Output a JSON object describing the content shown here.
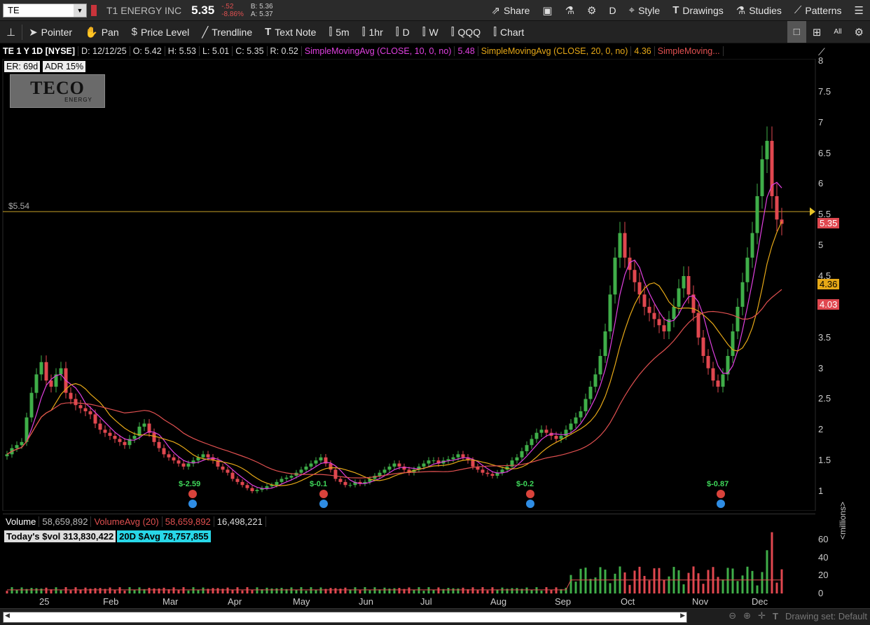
{
  "topbar": {
    "symbol": "TE",
    "company": "T1 ENERGY INC",
    "last": "5.35",
    "change": "-.52",
    "change_pct": "-8.86%",
    "bid": "B: 5.36",
    "ask": "A: 5.37",
    "share": "Share",
    "period": "D",
    "style": "Style",
    "drawings": "Drawings",
    "studies": "Studies",
    "patterns": "Patterns"
  },
  "toolbar": {
    "pointer": "Pointer",
    "pan": "Pan",
    "price_level": "Price Level",
    "trendline": "Trendline",
    "text_note": "Text Note",
    "t5m": "5m",
    "t1hr": "1hr",
    "tD": "D",
    "tW": "W",
    "qqq": "QQQ",
    "chart": "Chart",
    "all": "All"
  },
  "header": {
    "title": "TE 1 Y 1D [NYSE]",
    "date": "D: 12/12/25",
    "open": "O: 5.42",
    "high": "H: 5.53",
    "low": "L: 5.01",
    "close": "C: 5.35",
    "range": "R: 0.52",
    "sma10": "SimpleMovingAvg (CLOSE, 10, 0, no)",
    "sma10_val": "5.48",
    "sma20": "SimpleMovingAvg (CLOSE, 20, 0, no)",
    "sma20_val": "4.36",
    "sma_more": "SimpleMoving..."
  },
  "badges": {
    "er": "ER: 69d",
    "adr": "ADR 15%",
    "logo_word": "TECO",
    "logo_sub": "ENERGY"
  },
  "price_line": {
    "label": "$5.54",
    "value": 5.54
  },
  "price_axis": {
    "ticks": [
      "8",
      "7.5",
      "7",
      "6.5",
      "6",
      "5.5",
      "5",
      "4.5",
      "4",
      "3.5",
      "3",
      "2.5",
      "2",
      "1.5",
      "1"
    ],
    "tag_last": "5.35",
    "tag_sma20": "4.36",
    "tag_sma50": "4.03"
  },
  "earnings": [
    "$-2.59",
    "$-0.1",
    "$-0.2",
    "$-0.87"
  ],
  "volume": {
    "label": "Volume",
    "value": "58,659,892",
    "avg_label": "VolumeAvg (20)",
    "avg_value": "58,659,892",
    "avg2": "16,498,221",
    "today": "Today's $vol 313,830,422",
    "avg20": "20D $Avg 78,757,855",
    "ticks": [
      "60",
      "40",
      "20",
      "0"
    ],
    "unit": "<millions>"
  },
  "x_axis": [
    "25",
    "Feb",
    "Mar",
    "Apr",
    "May",
    "Jun",
    "Jul",
    "Aug",
    "Sep",
    "Oct",
    "Nov",
    "Dec"
  ],
  "bottom": {
    "drawing_set": "Drawing set: Default"
  },
  "colors": {
    "up": "#3fae49",
    "down": "#e0474f",
    "sma10": "#e040e0",
    "sma20": "#e6a817",
    "sma50": "#e05050",
    "price_line": "#c9a227"
  },
  "chart_data": {
    "type": "candlestick",
    "ylim": [
      0.8,
      8.2
    ],
    "closes": [
      1.6,
      1.7,
      1.75,
      1.8,
      2.2,
      2.6,
      2.9,
      3.1,
      2.8,
      2.7,
      2.9,
      3.0,
      2.6,
      2.5,
      2.4,
      2.35,
      2.3,
      2.25,
      2.1,
      2.0,
      1.95,
      1.9,
      1.85,
      1.8,
      1.75,
      1.85,
      1.9,
      2.05,
      2.1,
      1.95,
      1.8,
      1.7,
      1.6,
      1.55,
      1.5,
      1.45,
      1.4,
      1.45,
      1.5,
      1.55,
      1.6,
      1.55,
      1.5,
      1.4,
      1.35,
      1.3,
      1.2,
      1.15,
      1.1,
      1.05,
      1.0,
      1.02,
      1.05,
      1.08,
      1.1,
      1.15,
      1.2,
      1.22,
      1.25,
      1.3,
      1.35,
      1.4,
      1.45,
      1.5,
      1.55,
      1.45,
      1.35,
      1.2,
      1.15,
      1.1,
      1.1,
      1.15,
      1.12,
      1.15,
      1.2,
      1.25,
      1.3,
      1.35,
      1.4,
      1.45,
      1.4,
      1.35,
      1.3,
      1.35,
      1.4,
      1.45,
      1.5,
      1.5,
      1.45,
      1.5,
      1.52,
      1.55,
      1.6,
      1.55,
      1.5,
      1.4,
      1.35,
      1.3,
      1.28,
      1.25,
      1.3,
      1.35,
      1.4,
      1.5,
      1.55,
      1.65,
      1.75,
      1.85,
      1.95,
      2.0,
      1.95,
      1.9,
      1.85,
      1.9,
      2.0,
      2.1,
      2.2,
      2.3,
      2.5,
      2.7,
      2.9,
      3.2,
      3.6,
      4.2,
      4.8,
      5.2,
      4.8,
      4.6,
      4.4,
      4.2,
      4.0,
      3.9,
      3.8,
      3.7,
      3.6,
      3.8,
      4.0,
      4.3,
      4.5,
      4.2,
      3.9,
      3.5,
      3.2,
      3.0,
      2.8,
      2.7,
      2.9,
      3.2,
      3.6,
      4.0,
      4.4,
      4.8,
      5.2,
      5.8,
      6.4,
      6.7,
      5.8,
      5.42,
      5.35
    ],
    "volume_max": 70
  }
}
